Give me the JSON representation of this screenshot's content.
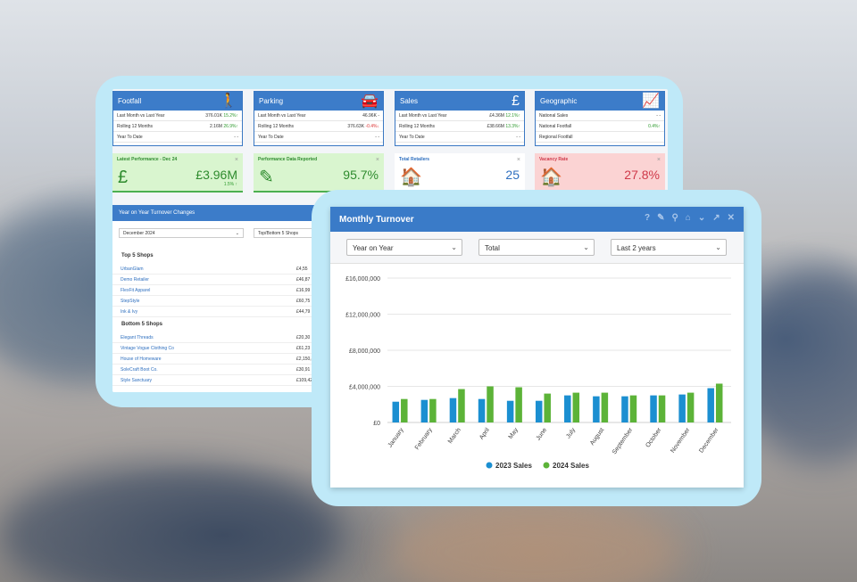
{
  "kpis": [
    {
      "title": "Footfall",
      "icon": "walking-person-icon",
      "glyph": "🚶",
      "rows": [
        {
          "label": "Last Month vs Last Year",
          "value": "376.01K",
          "change": "15.2%",
          "trend": "up"
        },
        {
          "label": "Rolling 12 Months",
          "value": "2.16M",
          "change": "26.9%",
          "trend": "up"
        },
        {
          "label": "Year To Date",
          "value": "-",
          "change": "-",
          "trend": ""
        }
      ]
    },
    {
      "title": "Parking",
      "icon": "car-icon",
      "glyph": "🚘",
      "rows": [
        {
          "label": "Last Month vs Last Year",
          "value": "46.96K",
          "change": "-",
          "trend": ""
        },
        {
          "label": "Rolling 12 Months",
          "value": "376.63K",
          "change": "-0.4%",
          "trend": "down"
        },
        {
          "label": "Year To Date",
          "value": "-",
          "change": "-",
          "trend": ""
        }
      ]
    },
    {
      "title": "Sales",
      "icon": "pound-icon",
      "glyph": "£",
      "rows": [
        {
          "label": "Last Month vs Last Year",
          "value": "£4.36M",
          "change": "12.1%",
          "trend": "up"
        },
        {
          "label": "Rolling 12 Months",
          "value": "£38.66M",
          "change": "13.3%",
          "trend": "up"
        },
        {
          "label": "Year To Date",
          "value": "-",
          "change": "-",
          "trend": ""
        }
      ]
    },
    {
      "title": "Geographic",
      "icon": "line-chart-icon",
      "glyph": "📈",
      "rows": [
        {
          "label": "National Sales",
          "value": "-",
          "change": "-",
          "trend": ""
        },
        {
          "label": "National Footfall",
          "value": "",
          "change": "0.4%",
          "trend": "up"
        },
        {
          "label": "Regional Footfall",
          "value": "",
          "change": "",
          "trend": ""
        }
      ]
    }
  ],
  "tiles": [
    {
      "title": "Latest Performance - Dec 24",
      "value": "£3.96M",
      "sub": "1.5%",
      "glyph": "£",
      "style": "green"
    },
    {
      "title": "Performance Data Reported",
      "value": "95.7%",
      "sub": "",
      "glyph": "✎",
      "style": "green"
    },
    {
      "title": "Total Retailers",
      "value": "25",
      "sub": "",
      "glyph": "🏠",
      "style": "white"
    },
    {
      "title": "Vacancy Rate",
      "value": "27.8%",
      "sub": "",
      "glyph": "🏠",
      "style": "red"
    }
  ],
  "yoy": {
    "title": "Year on Year Turnover Changes",
    "month_select": "December 2024",
    "mode_select": "Top/Bottom 5 Shops",
    "top_label": "Top 5 Shops",
    "bottom_label": "Bottom 5 Shops",
    "top": [
      {
        "name": "UrbanGlam",
        "value": "£4,55"
      },
      {
        "name": "Demo Retailer",
        "value": "£46,87"
      },
      {
        "name": "FlexFit Apparel",
        "value": "£16,99"
      },
      {
        "name": "StepStyle",
        "value": "£60,75"
      },
      {
        "name": "Ink & Ivy",
        "value": "£44,79"
      }
    ],
    "bottom": [
      {
        "name": "Elegant Threads",
        "value": "£20,30"
      },
      {
        "name": "Vintage Vogue Clothing Co",
        "value": "£61,23"
      },
      {
        "name": "House of Homeware",
        "value": "£2,150,84"
      },
      {
        "name": "SoleCraft Boot Co.",
        "value": "£30,91"
      },
      {
        "name": "Style Sanctuary",
        "value": "£109,42"
      }
    ]
  },
  "monthly": {
    "title": "Monthly Turnover",
    "filters": [
      "Year on Year",
      "Total",
      "Last 2 years"
    ],
    "tools": [
      "help-icon",
      "edit-icon",
      "pin-icon",
      "home-icon",
      "collapse-icon",
      "expand-icon",
      "close-icon"
    ]
  },
  "chart_data": {
    "type": "bar",
    "title": "",
    "categories": [
      "January",
      "February",
      "March",
      "April",
      "May",
      "June",
      "July",
      "August",
      "September",
      "October",
      "November",
      "December"
    ],
    "series": [
      {
        "name": "2023 Sales",
        "color": "#1b8fd1",
        "values": [
          2300000,
          2500000,
          2700000,
          2600000,
          2400000,
          2400000,
          3000000,
          2900000,
          2900000,
          3000000,
          3100000,
          3800000
        ]
      },
      {
        "name": "2024 Sales",
        "color": "#5cb338",
        "values": [
          2600000,
          2600000,
          3700000,
          4000000,
          3900000,
          3200000,
          3300000,
          3300000,
          3000000,
          3000000,
          3300000,
          4300000
        ]
      }
    ],
    "yticks": [
      "£0",
      "£4,000,000",
      "£8,000,000",
      "£12,000,000",
      "£16,000,000"
    ],
    "ylim": [
      0,
      16000000
    ],
    "grid": true,
    "legend": "bottom"
  }
}
